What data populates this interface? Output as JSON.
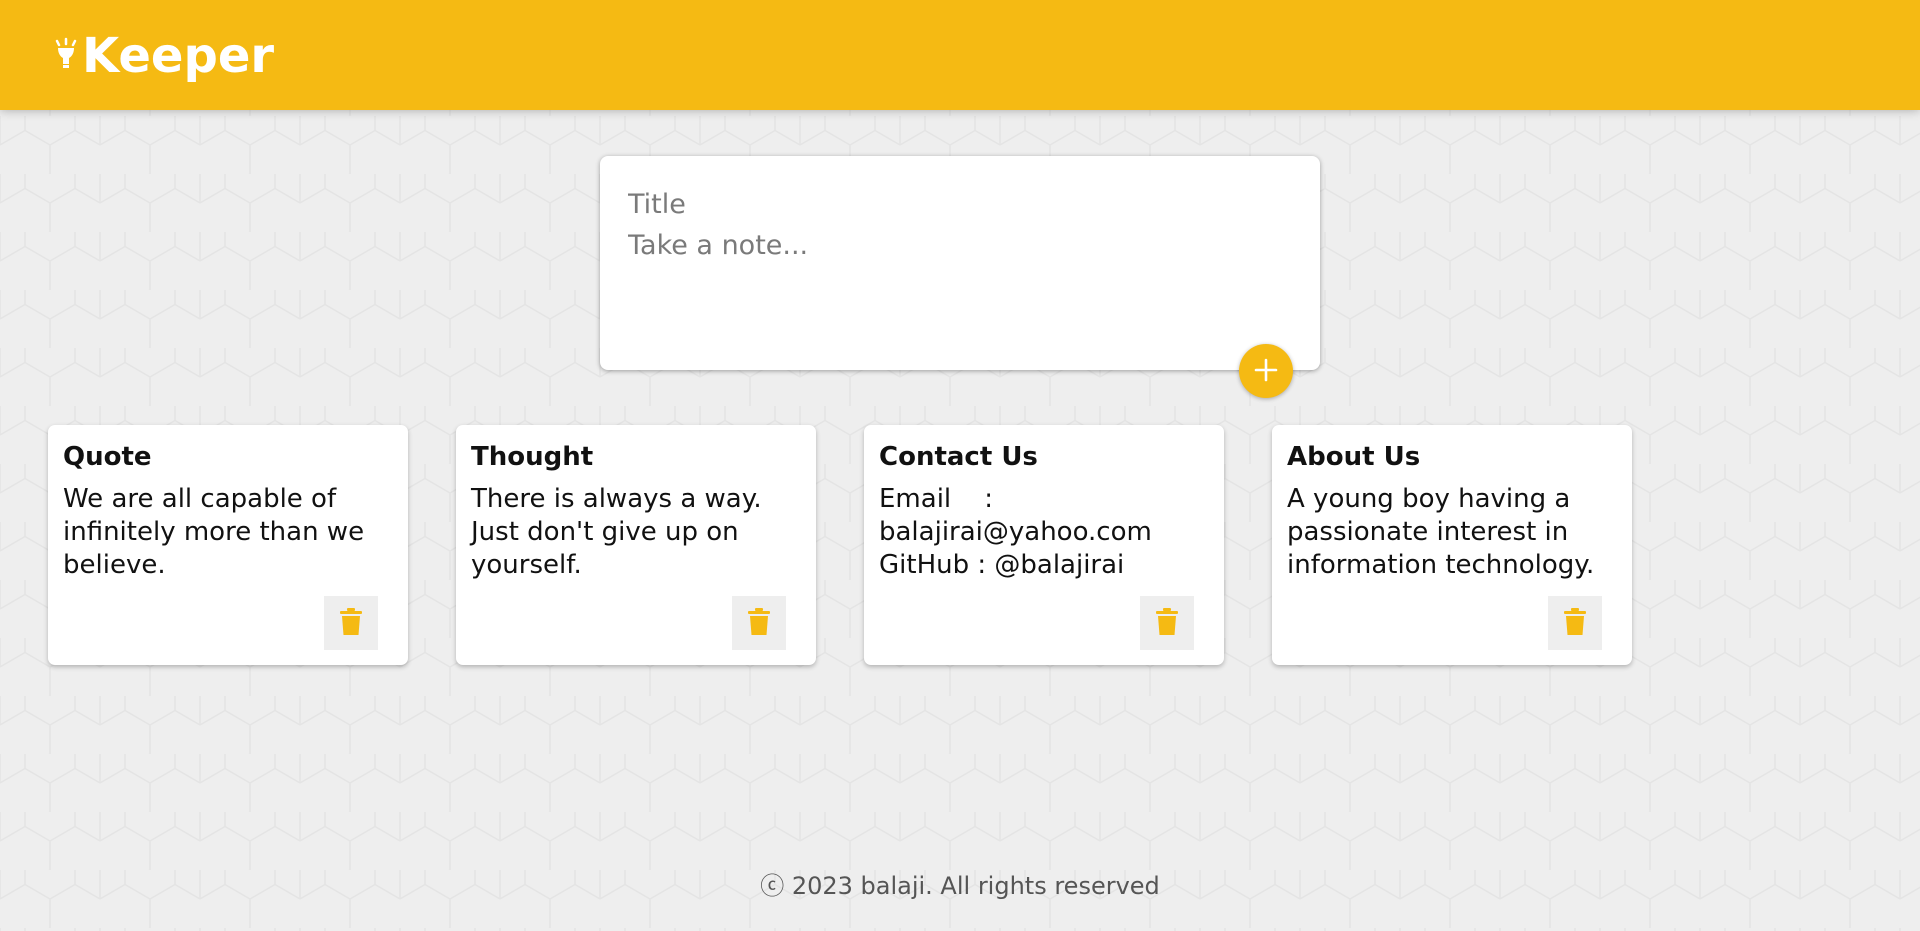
{
  "header": {
    "brand_name": "Keeper",
    "brand_icon": "lightbulb-icon"
  },
  "composer": {
    "title_placeholder": "Title",
    "content_placeholder": "Take a note...",
    "add_icon": "plus-icon"
  },
  "notes": [
    {
      "title": "Quote",
      "content": "We are all capable of infinitely more than we believe."
    },
    {
      "title": "Thought",
      "content": "There is always a way. Just don't give up on yourself."
    },
    {
      "title": "Contact Us",
      "content": "Email    :\nbalajirai@yahoo.com\nGitHub : @balajirai"
    },
    {
      "title": "About Us",
      "content": "A young boy having a passionate interest in information technology."
    }
  ],
  "delete_icon": "trash-icon",
  "footer": {
    "copyright": "ⓒ 2023 balaji. All rights reserved"
  },
  "colors": {
    "accent": "#f5ba13",
    "background": "#eeeeee",
    "card": "#ffffff"
  }
}
